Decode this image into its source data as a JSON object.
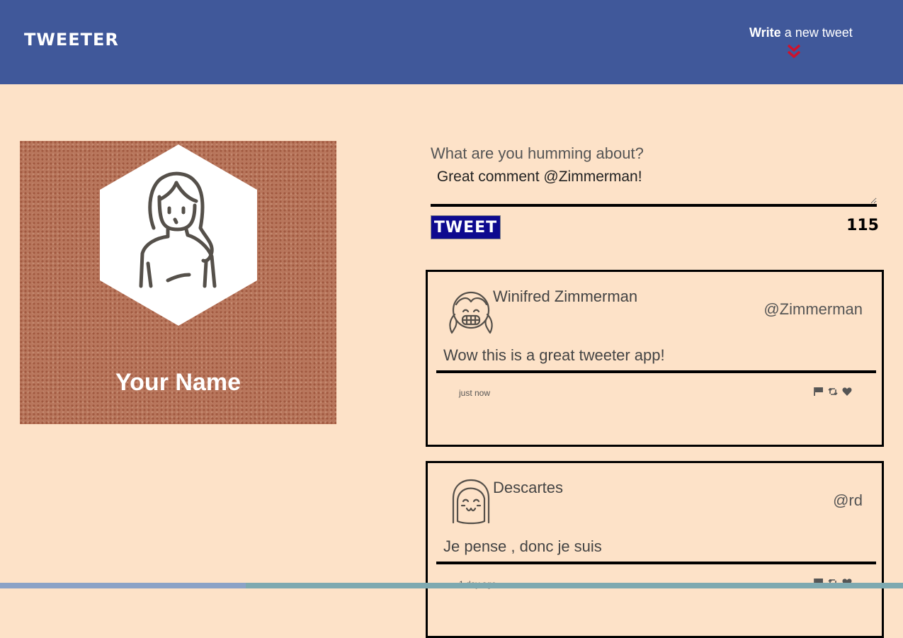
{
  "nav": {
    "brand": "TWEETER",
    "compose_toggle_bold": "Write",
    "compose_toggle_rest": " a new tweet"
  },
  "profile": {
    "name": "Your Name",
    "avatar_icon": "woman-long-hair-avatar-icon"
  },
  "compose": {
    "label": "What are you humming about?",
    "text": " Great comment @Zimmerman!",
    "button_label": "Tweet",
    "counter": "115"
  },
  "tweets": [
    {
      "name": "Winifred Zimmerman",
      "handle": "@Zimmerman",
      "body": "Wow this is a great tweeter app!",
      "time": "just now",
      "avatar_icon": "girl-pigtails-grin-avatar-icon"
    },
    {
      "name": "Descartes",
      "handle": "@rd",
      "body": "Je pense , donc je suis",
      "time": "1 day ago",
      "avatar_icon": "bob-hair-smile-avatar-icon"
    }
  ],
  "icons": {
    "flag": "flag-icon",
    "retweet": "retweet-icon",
    "like": "heart-icon",
    "chevron": "double-chevron-down-icon"
  },
  "colors": {
    "nav_background": "#40589a",
    "page_background": "#fde2c8",
    "tweet_button": "#0e0a8f",
    "chevron": "#d0112b",
    "profile_background": "#b8765c"
  }
}
